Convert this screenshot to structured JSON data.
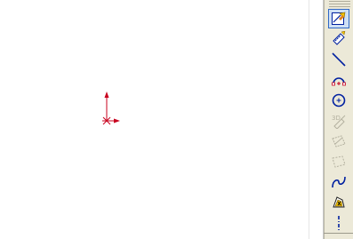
{
  "app": {
    "name": "sketch-editor"
  },
  "colors": {
    "origin_red": "#c8001e",
    "toolbar_bg": "#ece9d8",
    "icon_blue": "#0020a0",
    "icon_disabled": "#b4b1a0",
    "active_bg": "#cfe0f5",
    "active_border": "#3169c6"
  },
  "toolbar": {
    "tools": [
      {
        "name": "sketch-tool",
        "icon": "sketch-pencil-icon",
        "active": true,
        "enabled": true
      },
      {
        "name": "smart-dimension-tool",
        "icon": "smart-dimension-icon",
        "active": false,
        "enabled": true
      },
      {
        "name": "line-tool",
        "icon": "line-icon",
        "active": false,
        "enabled": true
      },
      {
        "name": "arc-tool",
        "icon": "arc-icon",
        "active": false,
        "enabled": true
      },
      {
        "name": "circle-tool",
        "icon": "circle-icon",
        "active": false,
        "enabled": true
      },
      {
        "name": "3d-sketch-tool",
        "icon": "3d-sketch-icon",
        "active": false,
        "enabled": false
      },
      {
        "name": "sketch-plane-tool",
        "icon": "sketch-plane-icon",
        "active": false,
        "enabled": false
      },
      {
        "name": "construction-plane-tool",
        "icon": "construction-plane-icon",
        "active": false,
        "enabled": false
      },
      {
        "name": "spline-tool",
        "icon": "spline-icon",
        "active": false,
        "enabled": true
      },
      {
        "name": "relations-tool",
        "icon": "relations-icon",
        "active": false,
        "enabled": true
      },
      {
        "name": "centerline-tool",
        "icon": "centerline-icon",
        "active": false,
        "enabled": true
      }
    ]
  }
}
